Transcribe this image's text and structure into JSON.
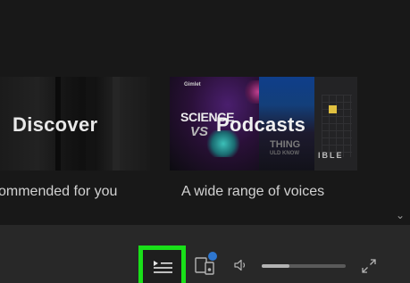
{
  "browse": {
    "cards": [
      {
        "title": "Discover",
        "subtitle": "commended for you"
      },
      {
        "title": "Podcasts",
        "subtitle": "A wide range of voices",
        "art_text": {
          "brand": "Gimlet",
          "science": "SCIENCE",
          "vs": "VS",
          "thing": "THING",
          "know": "ULD KNOW",
          "ible": "IBLE"
        }
      }
    ],
    "scroll_chevron": "⌄"
  },
  "player": {
    "volume_level": 0.33,
    "device_badge_color": "#2e77d0",
    "queue_highlight_color": "#19e019",
    "icons": [
      "queue-icon",
      "connect-device-icon",
      "volume-icon",
      "fullscreen-icon"
    ]
  }
}
